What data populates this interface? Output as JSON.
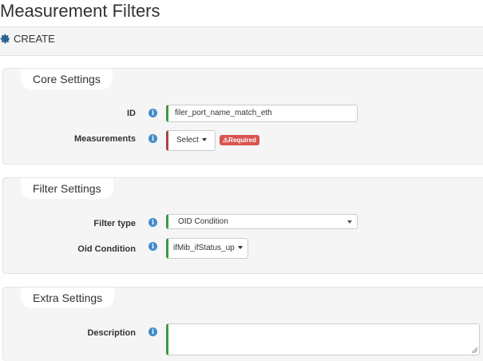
{
  "page": {
    "title": "Measurement Filters"
  },
  "toolbar": {
    "create_label": "CREATE",
    "create_icon": "gear-icon"
  },
  "core": {
    "legend": "Core Settings",
    "id_label": "ID",
    "id_value": "filer_port_name_match_eth",
    "measurements_label": "Measurements",
    "measurements_button": "Select",
    "required_badge": "Required"
  },
  "filter": {
    "legend": "Filter Settings",
    "type_label": "Filter type",
    "type_value": "OID Condition",
    "oid_label": "Oid Condition",
    "oid_button": "ifMib_ifStatus_up"
  },
  "extra": {
    "legend": "Extra Settings",
    "description_label": "Description",
    "description_value": ""
  },
  "colors": {
    "valid": "#3c9a3c",
    "invalid": "#a94442",
    "info": "#428bca",
    "required_badge": "#d9534f"
  }
}
